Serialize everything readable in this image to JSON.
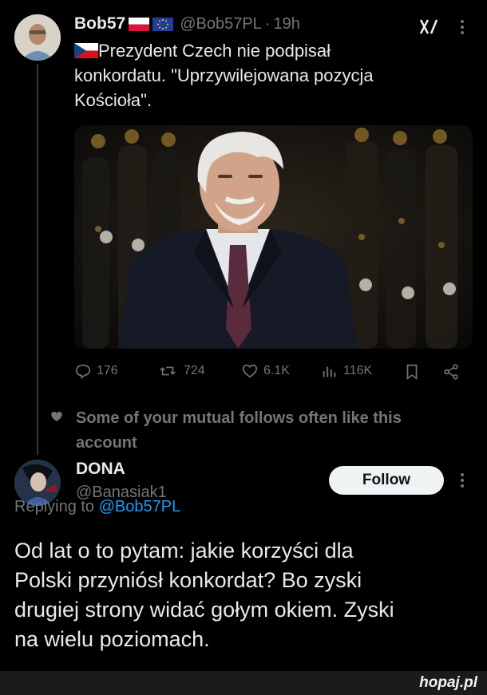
{
  "tweet": {
    "author_name": "Bob57",
    "handle": "@Bob57PL",
    "separator": "·",
    "time": "19h",
    "text_line1": "Prezydent Czech nie podpisał",
    "text_line2": "konkordatu. \"Uprzywilejowana pozycja",
    "text_line3": "Kościoła\".",
    "stats": {
      "replies": "176",
      "reposts": "724",
      "likes": "6.1K",
      "views": "116K"
    }
  },
  "social_context": {
    "line1": "Some of your mutual follows often like this",
    "line2": "account"
  },
  "reply": {
    "author_name": "DONA",
    "handle": "@Banasiak1",
    "replying_prefix": "Replying to",
    "replying_handle": "@Bob57PL",
    "follow_label": "Follow",
    "text_line1": "Od lat o to pytam: jakie korzyści dla",
    "text_line2": "Polski przyniósł konkordat? Bo zyski",
    "text_line3": "drugiej strony widać gołym okiem. Zyski",
    "text_line4": "na wielu poziomach."
  },
  "watermark": "hopaj.pl",
  "icons": [
    "grok-icon",
    "more-icon",
    "reply-icon",
    "repost-icon",
    "like-icon",
    "views-icon",
    "bookmark-icon",
    "share-icon",
    "heart-small-icon"
  ],
  "colors": {
    "background": "#000000",
    "text": "#e7e9ea",
    "muted": "#71767b",
    "link": "#1d9bf0",
    "button": "#eff3f4"
  }
}
